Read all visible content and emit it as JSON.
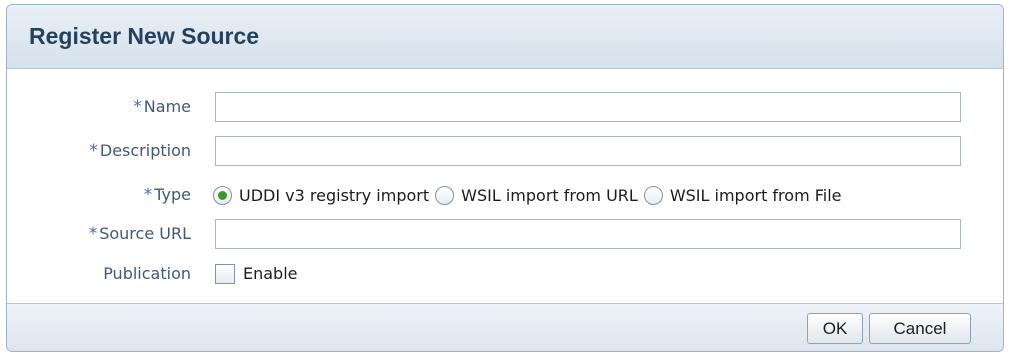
{
  "dialog": {
    "title": "Register New Source",
    "required_marker": "*"
  },
  "form": {
    "name": {
      "label": "Name",
      "value": ""
    },
    "description": {
      "label": "Description",
      "value": ""
    },
    "type": {
      "label": "Type",
      "options": [
        {
          "label": "UDDI v3 registry import",
          "checked": true
        },
        {
          "label": "WSIL import from URL",
          "checked": false
        },
        {
          "label": "WSIL import from File",
          "checked": false
        }
      ]
    },
    "source_url": {
      "label": "Source URL",
      "value": ""
    },
    "publication": {
      "label": "Publication",
      "checkbox_label": "Enable",
      "checked": false
    }
  },
  "buttons": {
    "ok": "OK",
    "cancel": "Cancel"
  }
}
